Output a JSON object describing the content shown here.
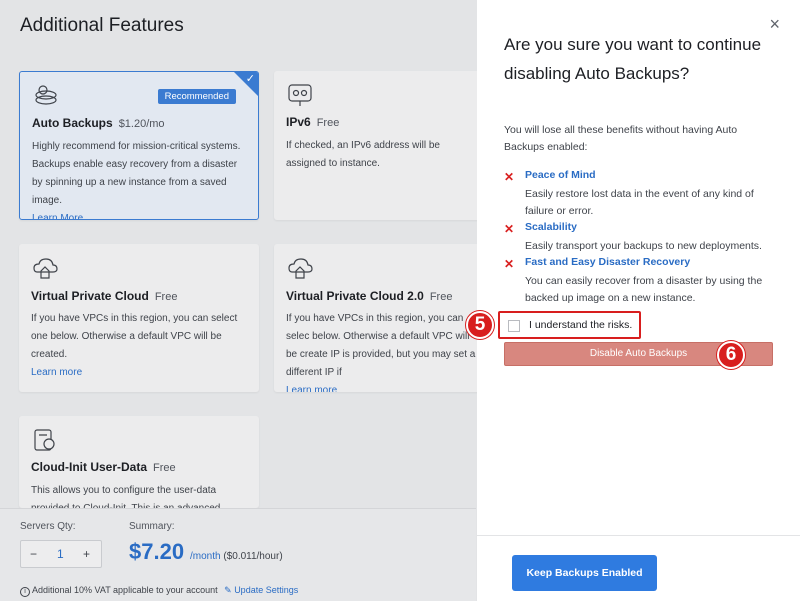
{
  "page": {
    "title": "Additional Features"
  },
  "cards": [
    {
      "title": "Auto Backups",
      "price": "$1.20/mo",
      "badge": "Recommended",
      "desc": "Highly recommend for mission-critical systems. Backups enable easy recovery from a disaster by spinning up a new instance from a saved image.",
      "link": "Learn More",
      "icon": "backup-stack-icon"
    },
    {
      "title": "IPv6",
      "price": "Free",
      "desc": "If checked, an IPv6 address will be assigned to instance.",
      "icon": "network-nodes-icon"
    },
    {
      "title": "Virtual Private Cloud",
      "price": "Free",
      "desc": "If you have VPCs in this region, you can select one below. Otherwise a default VPC will be created.",
      "link": "Learn more",
      "icon": "cloud-house-icon"
    },
    {
      "title": "Virtual Private Cloud 2.0",
      "price": "Free",
      "desc": "If you have VPCs in this region, you can selec below. Otherwise a default VPC will be create IP is provided, but you may set a different IP if",
      "link": "Learn more",
      "icon": "cloud-house-icon"
    },
    {
      "title": "Cloud-Init User-Data",
      "price": "Free",
      "desc": "This allows you to configure the user-data provided to Cloud-Init. This is an advanced feature",
      "icon": "user-data-icon"
    }
  ],
  "footer": {
    "servers_label": "Servers Qty:",
    "qty": "1",
    "minus": "−",
    "plus": "+",
    "summary_label": "Summary:",
    "total": "$7.20",
    "per": "/month",
    "hourly": "($0.011/hour)",
    "vat": "Additional 10% VAT applicable to your account",
    "update": "Update Settings"
  },
  "modal": {
    "close": "×",
    "heading": "Are you sure you want to continue disabling Auto Backups?",
    "intro": "You will lose all these benefits without having Auto Backups enabled:",
    "benefits": [
      {
        "title": "Peace of Mind",
        "desc": "Easily restore lost data in the event of any kind of failure or error."
      },
      {
        "title": "Scalability",
        "desc": "Easily transport your backups to new deployments."
      },
      {
        "title": "Fast and Easy Disaster Recovery",
        "desc": "You can easily recover from a disaster by using the backed up image on a new instance."
      }
    ],
    "ack_label": "I understand the risks.",
    "disable_button": "Disable Auto Backups",
    "keep_button": "Keep Backups Enabled",
    "x_mark": "✕"
  },
  "annotations": {
    "step5": "5",
    "step6": "6"
  },
  "colors": {
    "accent": "#2f7be0",
    "danger": "#d81e1e",
    "disabled_danger": "#d8877f"
  }
}
